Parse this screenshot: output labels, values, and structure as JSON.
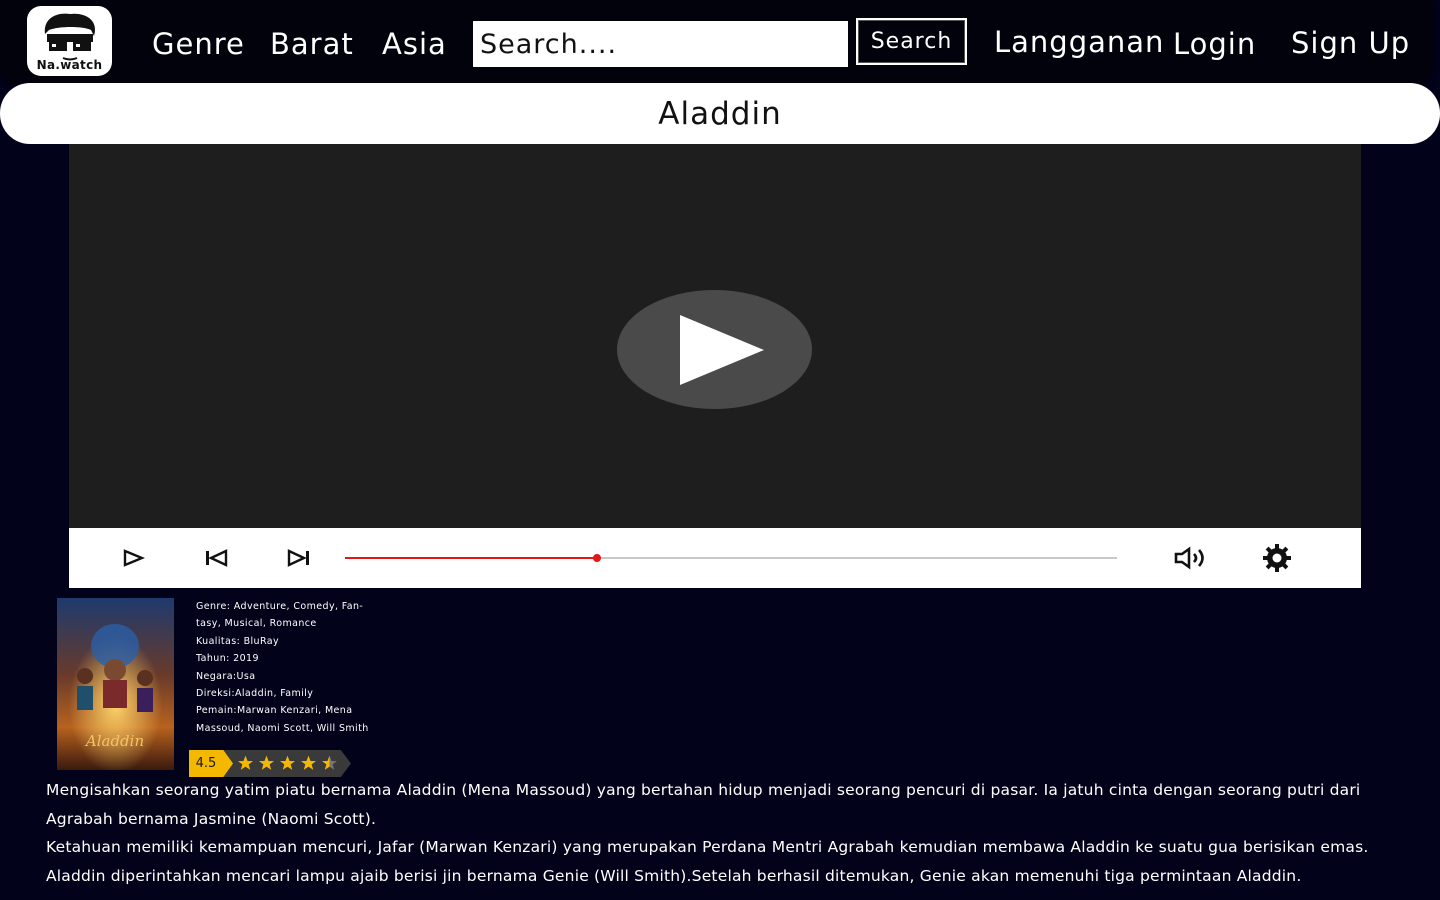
{
  "brand": {
    "logo_text": "Na.watch"
  },
  "nav": {
    "genre": "Genre",
    "barat": "Barat",
    "asia": "Asia",
    "search_placeholder": "Search....",
    "search_button": "Search",
    "langganan": "Langganan",
    "login": "Login",
    "signup": "Sign Up"
  },
  "page": {
    "title": "Aladdin"
  },
  "player": {
    "progress": 0.326,
    "icons": [
      "play-icon",
      "skip-back-icon",
      "skip-forward-icon",
      "volume-icon",
      "settings-icon"
    ],
    "accent": "#e01818"
  },
  "movie": {
    "genre": "Genre: Adventure, Comedy, Fan-",
    "genre_cont": "tasy, Musical, Romance",
    "kualitas": "Kualitas: BluRay",
    "tahun": "Tahun: 2019",
    "negara": "Negara:Usa",
    "direksi": "Direksi:Aladdin, Family",
    "pemain": "Pemain:Marwan Kenzari, Mena",
    "pemain_cont": "Massoud, Naomi Scott, Will Smith",
    "rating": "4.5",
    "rating_stars": 4.5,
    "description_1": "Mengisahkan seorang yatim piatu bernama Aladdin (Mena Massoud) yang bertahan hidup menjadi seorang pencuri di pasar. Ia jatuh cinta dengan seorang putri dari Agrabah bernama Jasmine (Naomi Scott).",
    "description_2": "Ketahuan memiliki kemampuan mencuri, Jafar (Marwan Kenzari) yang merupakan Perdana Mentri Agrabah kemudian membawa Aladdin ke suatu gua berisikan emas. Aladdin diperintahkan mencari lampu ajaib berisi jin bernama Genie (Will Smith).Setelah berhasil ditemukan, Genie akan memenuhi tiga permintaan Aladdin."
  },
  "colors": {
    "background": "#02021a",
    "star": "#f5b800"
  }
}
